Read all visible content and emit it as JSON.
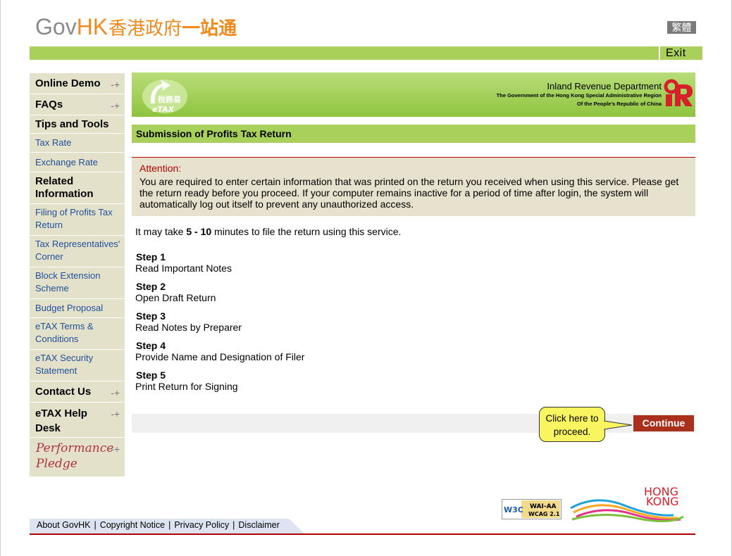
{
  "header": {
    "logo_gov": "Gov",
    "logo_hk": "HK",
    "logo_zh_a": "香港政府",
    "logo_zh_b": "一站通",
    "lang_label": "繁體",
    "exit_label": "Exit"
  },
  "sidebar": {
    "items": [
      {
        "label": "Online Demo",
        "kind": "head",
        "expandable": true
      },
      {
        "label": "FAQs",
        "kind": "head",
        "expandable": true
      },
      {
        "label": "Tips and Tools",
        "kind": "head",
        "expandable": false
      },
      {
        "label": "Tax Rate",
        "kind": "link"
      },
      {
        "label": "Exchange Rate",
        "kind": "link"
      },
      {
        "label_line1": "Related",
        "label_line2": "Information",
        "kind": "head"
      },
      {
        "label_line1": "Filing of Profits Tax",
        "label_line2": "Return",
        "kind": "link"
      },
      {
        "label_line1": "Tax Representatives'",
        "label_line2": "Corner",
        "kind": "link"
      },
      {
        "label_line1": "Block Extension",
        "label_line2": "Scheme",
        "kind": "link"
      },
      {
        "label": "Budget Proposal",
        "kind": "link"
      },
      {
        "label_line1": "eTAX Terms &",
        "label_line2": "Conditions",
        "kind": "link"
      },
      {
        "label_line1": "eTAX Security",
        "label_line2": "Statement",
        "kind": "link"
      },
      {
        "label": "Contact Us",
        "kind": "head",
        "expandable": true
      },
      {
        "label_line1": "eTAX Help",
        "label_line2": "Desk",
        "kind": "head",
        "expandable": true
      },
      {
        "label_line1": "Performance",
        "label_line2": "Pledge",
        "kind": "script",
        "expandable": true
      }
    ],
    "plus_glyph": "-+"
  },
  "banner": {
    "etax_zh": "稅務易",
    "etax_en": "eTAX",
    "dept_name": "Inland Revenue Department",
    "dept_sub1": "The Government of the Hong Kong Special Administrative Region",
    "dept_sub2": "Of the People's Republic of China"
  },
  "page_title": "Submission of Profits Tax Return",
  "attention": {
    "label": "Attention:",
    "body": "You are required to enter certain information that was printed on the return you received when using this service. Please get the return ready before you proceed. If your computer remains inactive for a period of time after login, the system will automatically log out itself to prevent any unauthorized access."
  },
  "intro": {
    "prefix": "It may take ",
    "duration": "5 - 10",
    "suffix": " minutes to file the return using this service."
  },
  "steps": [
    {
      "title": "Step 1",
      "desc": "Read Important Notes"
    },
    {
      "title": "Step 2",
      "desc": "Open Draft Return"
    },
    {
      "title": "Step 3",
      "desc": "Read Notes by Preparer"
    },
    {
      "title": "Step 4",
      "desc": "Provide Name and Designation of Filer"
    },
    {
      "title": "Step 5",
      "desc": "Print Return for Signing"
    }
  ],
  "callout": {
    "line1": "Click here to",
    "line2": "proceed."
  },
  "continue_label": "Continue",
  "footer": {
    "links": [
      "About GovHK",
      "Copyright Notice",
      "Privacy Policy",
      "Disclaimer"
    ],
    "separator": "|",
    "w3c_label": "W3C",
    "wcag_line1": "WAI-AA",
    "wcag_line2": "WCAG 2.1",
    "brand_line1": "HONG",
    "brand_line2": "KONG"
  },
  "colors": {
    "green": "#a8d05a",
    "orange": "#f08a1c",
    "dark_red": "#a8301c",
    "attention_red": "#b00000",
    "sidebar_bg": "#e4e1cb",
    "link_blue": "#1f4f99"
  }
}
